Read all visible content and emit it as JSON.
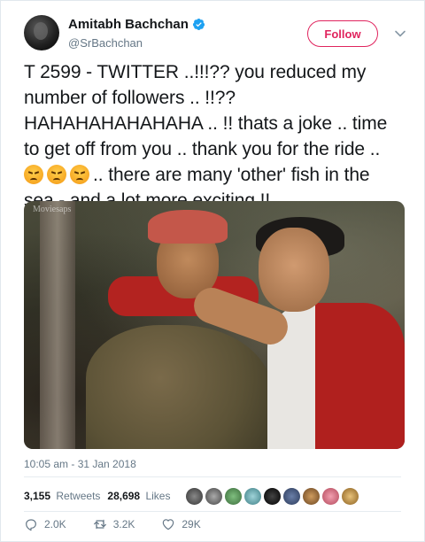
{
  "header": {
    "display_name": "Amitabh Bachchan",
    "handle": "@SrBachchan",
    "follow_label": "Follow"
  },
  "tweet": {
    "line_1": "T 2599 - TWITTER ..!!!??  you reduced my",
    "line_2": "number of followers .. !!??",
    "line_3": "HAHAHAHAHAHAHA .. !! thats a joke .. time",
    "line_4": "to get off from you .. thank you for the ride ..",
    "line_5_text": ".. there are many 'other' fish in the",
    "line_6": "sea - and a lot more exciting !!",
    "emoji_icon": "angry-face-emoji",
    "photo_watermark": "Moviesaps"
  },
  "meta": {
    "timestamp": "10:05 am - 31 Jan 2018",
    "retweets_count": "3,155",
    "retweets_label": "Retweets",
    "likes_count": "28,698",
    "likes_label": "Likes"
  },
  "actions": {
    "reply_count": "2.0K",
    "retweet_count": "3.2K",
    "like_count": "29K"
  },
  "colors": {
    "follow_accent": "#e0245e",
    "verified_blue": "#1da1f2",
    "secondary_text": "#657786"
  }
}
